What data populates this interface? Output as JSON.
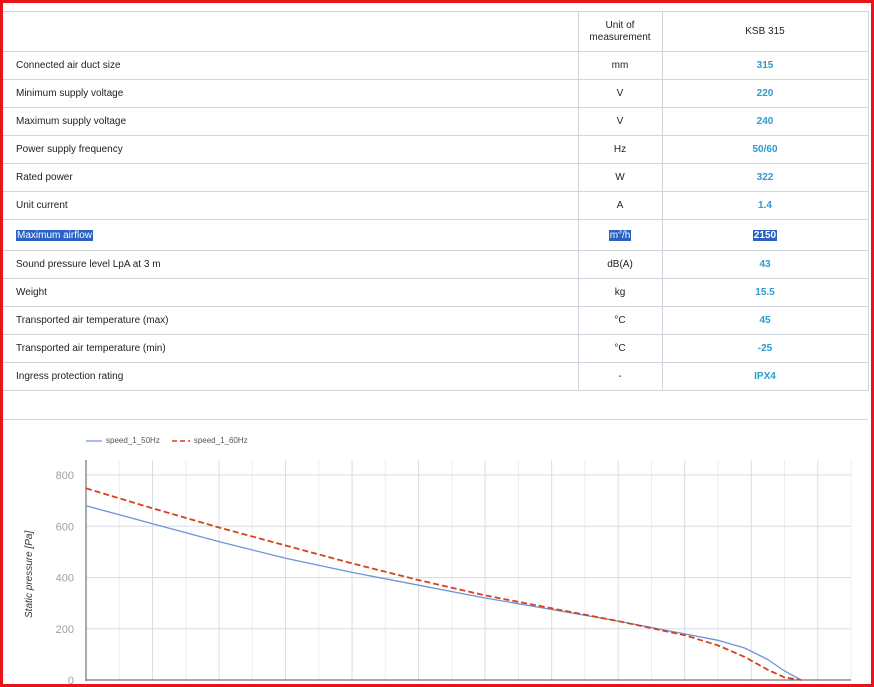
{
  "table": {
    "header": {
      "parameter": "",
      "unit": "Unit of measurement",
      "model": "KSB 315"
    },
    "rows": [
      {
        "name": "Connected air duct size",
        "unit": "mm",
        "value": "315"
      },
      {
        "name": "Minimum supply voltage",
        "unit": "V",
        "value": "220"
      },
      {
        "name": "Maximum supply voltage",
        "unit": "V",
        "value": "240"
      },
      {
        "name": "Power supply frequency",
        "unit": "Hz",
        "value": "50/60"
      },
      {
        "name": "Rated power",
        "unit": "W",
        "value": "322"
      },
      {
        "name": "Unit current",
        "unit": "A",
        "value": "1.4"
      },
      {
        "name": "Maximum airflow",
        "unit": "m³/h",
        "value": "2150",
        "selected": true
      },
      {
        "name": "Sound pressure level LpA at 3 m",
        "unit": "dB(A)",
        "value": "43"
      },
      {
        "name": "Weight",
        "unit": "kg",
        "value": "15.5"
      },
      {
        "name": "Transported air temperature (max)",
        "unit": "°C",
        "value": "45"
      },
      {
        "name": "Transported air temperature (min)",
        "unit": "°C",
        "value": "-25"
      },
      {
        "name": "Ingress protection rating",
        "unit": "-",
        "value": "IPX4"
      }
    ],
    "unit_m3_base": "m",
    "unit_m3_sup": "3",
    "unit_m3_tail": "/h"
  },
  "colors": {
    "accent_value": "#2d9bd3",
    "selection": "#2b61c2",
    "frame": "#e8141c",
    "series_50": "#6f93d6",
    "series_60": "#d6421c"
  },
  "chart_data": {
    "type": "line",
    "ylabel": "Static pressure [Pa]",
    "xlabel": "",
    "ylim": [
      0,
      800
    ],
    "yticks": [
      0,
      200,
      400,
      600,
      800
    ],
    "xlim": [
      0,
      2300
    ],
    "grid": true,
    "legend": "top-left",
    "series": [
      {
        "name": "speed_1_50Hz",
        "style": "solid",
        "x": [
          0,
          200,
          400,
          600,
          800,
          1000,
          1200,
          1400,
          1600,
          1800,
          1900,
          1980,
          2050,
          2100,
          2150
        ],
        "y": [
          680,
          610,
          540,
          475,
          420,
          370,
          320,
          275,
          230,
          180,
          155,
          125,
          80,
          35,
          0
        ]
      },
      {
        "name": "speed_1_60Hz",
        "style": "dashed",
        "x": [
          0,
          200,
          400,
          600,
          800,
          1000,
          1200,
          1400,
          1600,
          1800,
          1900,
          1980,
          2050,
          2100,
          2150
        ],
        "y": [
          748,
          670,
          595,
          525,
          455,
          390,
          330,
          280,
          230,
          175,
          135,
          90,
          40,
          10,
          0
        ]
      }
    ]
  }
}
